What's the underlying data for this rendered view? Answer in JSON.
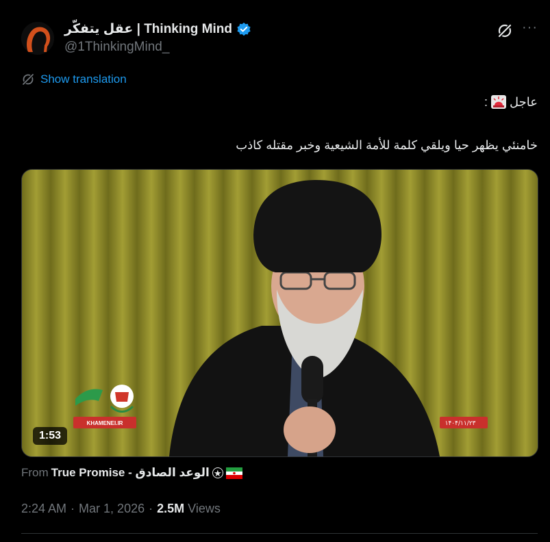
{
  "author": {
    "display_name": "عقل يتفكّر | Thinking Mind",
    "handle": "@1ThinkingMind_",
    "verified": true,
    "avatar_icon": "orange-head-silhouette-icon"
  },
  "actions": {
    "grok_icon": "grok-icon",
    "more_label": "···"
  },
  "translation": {
    "label": "Show translation"
  },
  "post": {
    "line1": "عاجل",
    "line1_suffix": ":",
    "line1_emoji": "police-light-emoji",
    "line2": "خامنئي يظهر حيا ويلقي كلمة للأمة الشيعية وخبر مقتله كاذب"
  },
  "media": {
    "duration": "1:53",
    "watermark": "KHAMENEI.IR",
    "date_overlay": "۱۴۰۴/۱۱/۲۳"
  },
  "source": {
    "prefix": "From",
    "name": "True Promise - الوعد الصادق",
    "flag_icon": "iran-flag-emoji"
  },
  "meta": {
    "time": "2:24 AM",
    "sep1": "·",
    "date": "Mar 1, 2026",
    "sep2": "·",
    "views_count": "2.5M",
    "views_label": "Views"
  },
  "colors": {
    "background": "#000000",
    "accent": "#1d9bf0",
    "muted": "#71767b",
    "text": "#e7e9ea"
  }
}
